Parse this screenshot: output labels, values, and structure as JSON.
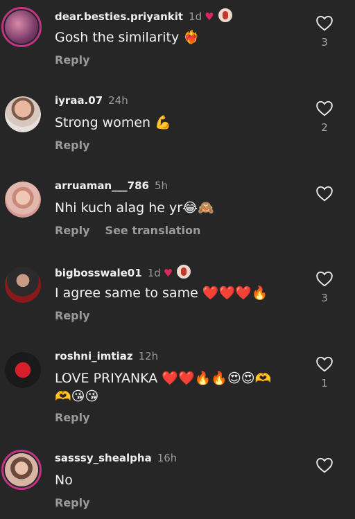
{
  "comments": [
    {
      "username": "dear.besties.priyankit",
      "time": "1d",
      "text": "Gosh the similarity ❤️‍🔥",
      "reply": "Reply",
      "likes": "3"
    },
    {
      "username": "iyraa.07",
      "time": "24h",
      "text": "Strong women 💪",
      "reply": "Reply",
      "likes": "2"
    },
    {
      "username": "arruaman___786",
      "time": "5h",
      "text": "Nhi kuch alag he yr😂🙈",
      "reply": "Reply",
      "see_translation": "See translation",
      "likes": ""
    },
    {
      "username": "bigbosswale01",
      "time": "1d",
      "text": "I agree same to same ❤️❤️❤️🔥",
      "reply": "Reply",
      "likes": "3"
    },
    {
      "username": "roshni_imtiaz",
      "time": "12h",
      "text_line1": "LOVE PRIYANKA ❤️❤️🔥🔥😍😍🫶",
      "text_line2": "🫶😘😘",
      "reply": "Reply",
      "likes": "1"
    },
    {
      "username": "sasssy_shealpha",
      "time": "16h",
      "text": "No",
      "reply": "Reply",
      "likes": ""
    }
  ],
  "colors": {
    "background": "#262626",
    "heart_red": "#e0245e",
    "story_ring": "#c13584"
  },
  "icons": {
    "like": "heart-outline-icon",
    "creator_heart": "heart-filled-icon"
  }
}
